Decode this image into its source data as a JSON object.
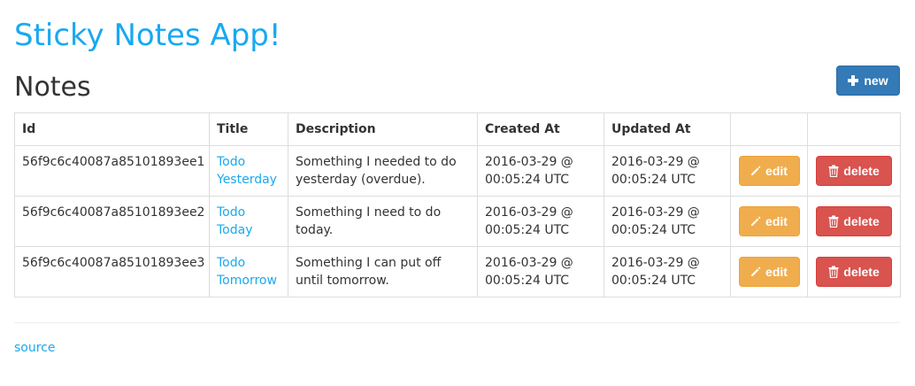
{
  "header": {
    "app_title": "Sticky Notes App!",
    "section_title": "Notes",
    "new_button_label": "new"
  },
  "table": {
    "columns": [
      "Id",
      "Title",
      "Description",
      "Created At",
      "Updated At",
      "",
      ""
    ],
    "rows": [
      {
        "id": "56f9c6c40087a85101893ee1",
        "title_line1": "Todo",
        "title_line2": "Yesterday",
        "description": "Something I needed to do yesterday (overdue).",
        "created_line1": "2016-03-29 @",
        "created_line2": "00:05:24 UTC",
        "updated_line1": "2016-03-29 @",
        "updated_line2": "00:05:24 UTC",
        "edit_label": "edit",
        "delete_label": "delete"
      },
      {
        "id": "56f9c6c40087a85101893ee2",
        "title_line1": "Todo",
        "title_line2": "Today",
        "description": "Something I need to do today.",
        "created_line1": "2016-03-29 @",
        "created_line2": "00:05:24 UTC",
        "updated_line1": "2016-03-29 @",
        "updated_line2": "00:05:24 UTC",
        "edit_label": "edit",
        "delete_label": "delete"
      },
      {
        "id": "56f9c6c40087a85101893ee3",
        "title_line1": "Todo",
        "title_line2": "Tomorrow",
        "description": "Something I can put off until tomorrow.",
        "created_line1": "2016-03-29 @",
        "created_line2": "00:05:24 UTC",
        "updated_line1": "2016-03-29 @",
        "updated_line2": "00:05:24 UTC",
        "edit_label": "edit",
        "delete_label": "delete"
      }
    ]
  },
  "footer": {
    "source_label": "source"
  },
  "colors": {
    "link": "#19a9f0",
    "primary": "#337ab7",
    "warning": "#f0ad4e",
    "danger": "#d9534f"
  },
  "icons": {
    "new": "plus-icon",
    "edit": "pencil-icon",
    "delete": "trash-icon"
  }
}
